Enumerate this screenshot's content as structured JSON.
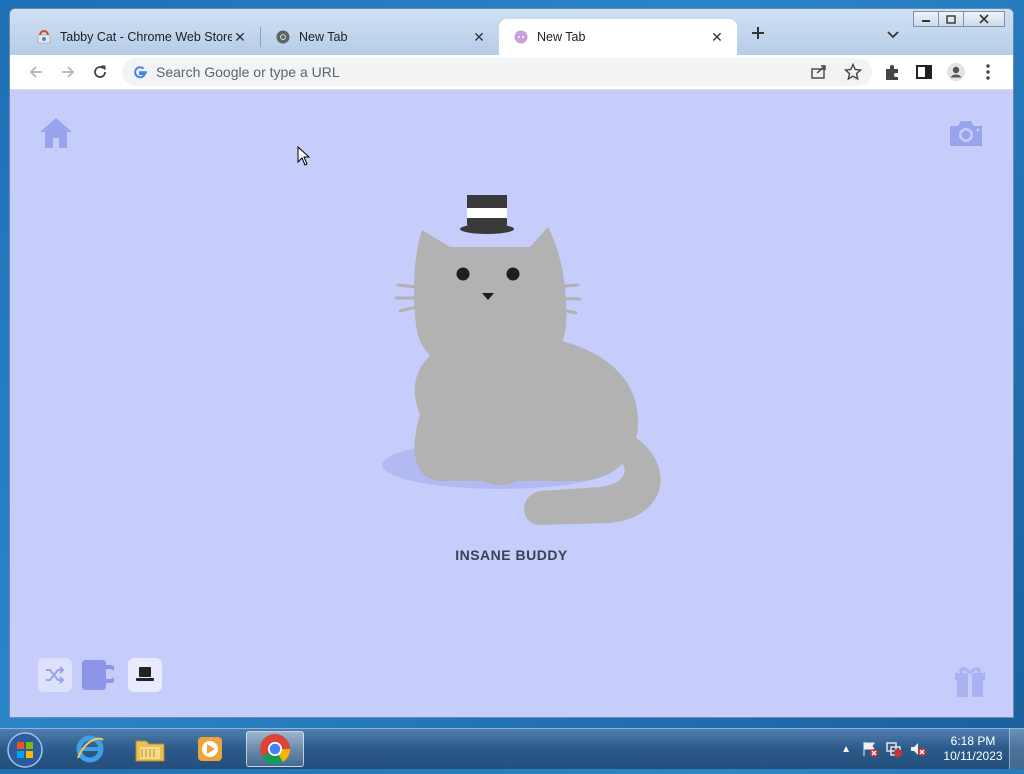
{
  "browser": {
    "tabs": [
      {
        "title": "Tabby Cat - Chrome Web Store",
        "icon": "chrome-web-store-icon",
        "active": false
      },
      {
        "title": "New Tab",
        "icon": "chrome-icon",
        "active": false
      },
      {
        "title": "New Tab",
        "icon": "tabby-cat-icon",
        "active": true
      }
    ],
    "omnibox": {
      "placeholder": "Search Google or type a URL",
      "value": ""
    }
  },
  "page": {
    "background": "#c7cdfb",
    "cat_name": "INSANE BUDDY",
    "cat_color": "#b2b2b2",
    "accessory": "top-hat"
  },
  "taskbar": {
    "apps": [
      "start-orb",
      "internet-explorer-icon",
      "file-explorer-icon",
      "media-player-icon",
      "chrome-icon"
    ],
    "time": "6:18 PM",
    "date": "10/11/2023"
  }
}
